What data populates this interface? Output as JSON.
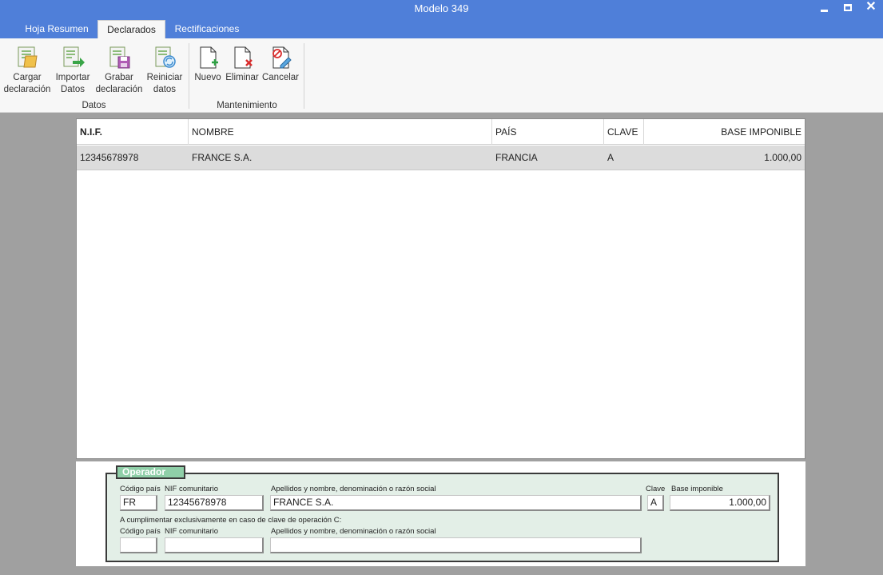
{
  "window": {
    "title": "Modelo 349",
    "minimize": "–",
    "maximize": "",
    "close": "✕"
  },
  "tabs": [
    {
      "label": "Hoja Resumen",
      "active": false
    },
    {
      "label": "Declarados",
      "active": true
    },
    {
      "label": "Rectificaciones",
      "active": false
    }
  ],
  "ribbon": {
    "groups": [
      {
        "label": "Datos",
        "buttons": [
          {
            "line1": "Cargar",
            "line2": "declaración",
            "icon": "load-declaration-icon"
          },
          {
            "line1": "Importar",
            "line2": "Datos",
            "icon": "import-data-icon"
          },
          {
            "line1": "Grabar",
            "line2": "declaración",
            "icon": "save-declaration-icon"
          },
          {
            "line1": "Reiniciar",
            "line2": "datos",
            "icon": "reset-data-icon"
          }
        ]
      },
      {
        "label": "Mantenimiento",
        "buttons": [
          {
            "line1": "Nuevo",
            "icon": "new-document-icon"
          },
          {
            "line1": "Eliminar",
            "icon": "delete-document-icon"
          },
          {
            "line1": "Cancelar",
            "icon": "cancel-edit-icon"
          }
        ]
      }
    ]
  },
  "table": {
    "columns": [
      "N.I.F.",
      "NOMBRE",
      "PAÍS",
      "CLAVE",
      "BASE IMPONIBLE"
    ],
    "rows": [
      [
        "12345678978",
        "FRANCE S.A.",
        "FRANCIA",
        "A",
        "1.000,00"
      ]
    ]
  },
  "operator": {
    "legend": "Operador",
    "labels": {
      "codigo_pais": "Código país",
      "nif": "NIF comunitario",
      "nombre": "Apellidos y nombre, denominación o razón social",
      "clave": "Clave",
      "base": "Base imponible",
      "note": "A cumplimentar exclusivamente en caso de clave de operación C:",
      "codigo_pais_2": "Código país",
      "nif_2": "NIF comunitario",
      "nombre_2": "Apellidos y nombre, denominación o razón social"
    },
    "values": {
      "codigo_pais": "FR",
      "nif": "12345678978",
      "nombre": "FRANCE S.A.",
      "clave": "A",
      "base": "1.000,00",
      "codigo_pais_2": "",
      "nif_2": "",
      "nombre_2": ""
    }
  },
  "colors": {
    "titlebar": "#4f7fd9",
    "panel_fill": "#e3efe7",
    "legend_fill": "#8fcfa8",
    "selected_row": "#dcdcdc"
  }
}
